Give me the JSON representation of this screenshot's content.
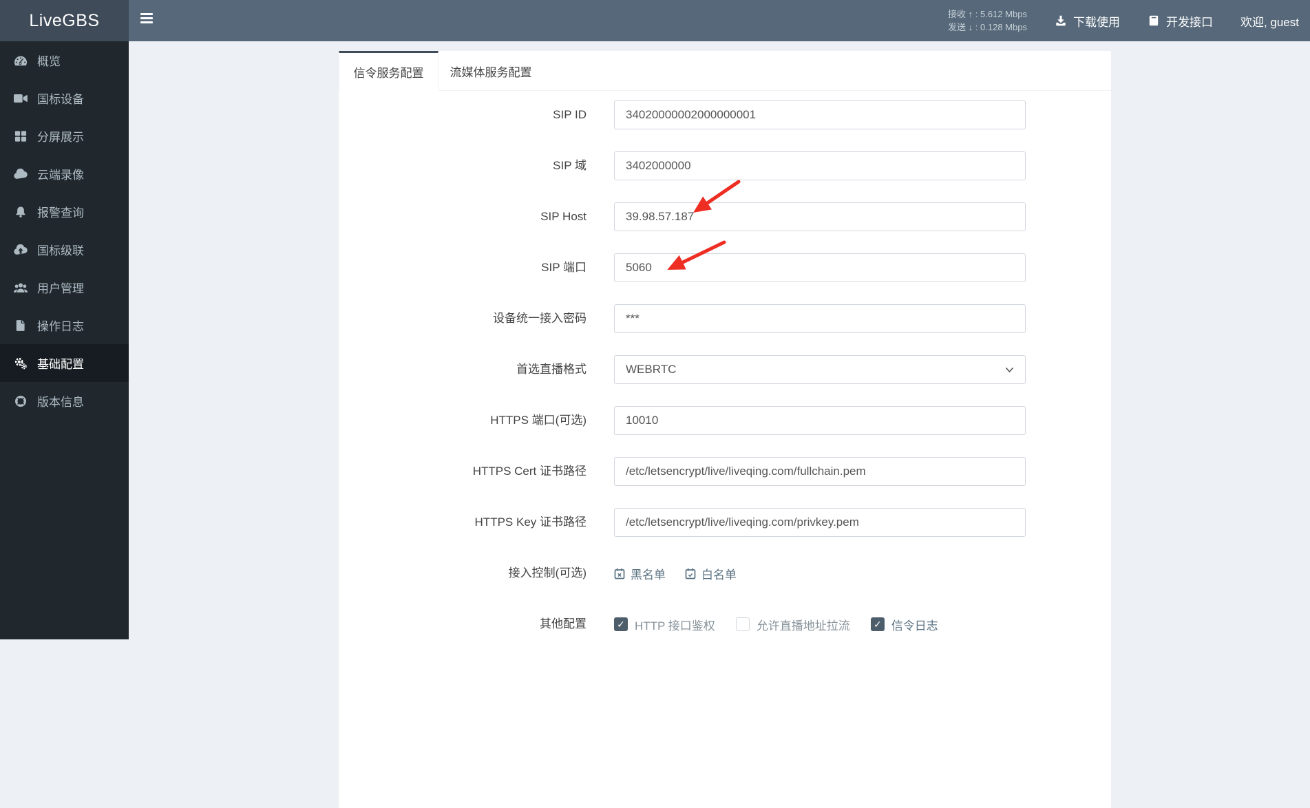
{
  "topbar": {
    "brand": "LiveGBS",
    "stats": {
      "recv_label": "接收",
      "recv_arrow": "↑",
      "recv_value": "5.612 Mbps",
      "send_label": "发送",
      "send_arrow": "↓",
      "send_value": "0.128 Mbps",
      "sep": ":"
    },
    "nav": [
      {
        "id": "download",
        "icon": "download-icon",
        "label": "下载使用"
      },
      {
        "id": "dev-api",
        "icon": "book-icon",
        "label": "开发接口"
      },
      {
        "id": "welcome-user",
        "icon": "",
        "label": "欢迎, guest"
      }
    ]
  },
  "sidebar": {
    "items": [
      {
        "id": "overview",
        "icon": "gauge-icon",
        "label": "概览",
        "active": false
      },
      {
        "id": "gb-devices",
        "icon": "video-camera-icon",
        "label": "国标设备",
        "active": false
      },
      {
        "id": "split-screen",
        "icon": "grid-icon",
        "label": "分屏展示",
        "active": false
      },
      {
        "id": "cloud-record",
        "icon": "cloud-icon",
        "label": "云端录像",
        "active": false
      },
      {
        "id": "alarm-query",
        "icon": "bell-icon",
        "label": "报警查询",
        "active": false
      },
      {
        "id": "gb-cascade",
        "icon": "cloud-upload-icon",
        "label": "国标级联",
        "active": false
      },
      {
        "id": "user-management",
        "icon": "users-icon",
        "label": "用户管理",
        "active": false
      },
      {
        "id": "operation-log",
        "icon": "file-icon",
        "label": "操作日志",
        "active": false
      },
      {
        "id": "basic-config",
        "icon": "gears-icon",
        "label": "基础配置",
        "active": true
      },
      {
        "id": "version-info",
        "icon": "ring-icon",
        "label": "版本信息",
        "active": false
      }
    ]
  },
  "tabs": [
    {
      "id": "signal-service-config",
      "label": "信令服务配置",
      "active": true
    },
    {
      "id": "media-service-config",
      "label": "流媒体服务配置",
      "active": false
    }
  ],
  "form": {
    "rows": [
      {
        "id": "sip-id",
        "label": "SIP ID",
        "value": "34020000002000000001"
      },
      {
        "id": "sip-domain",
        "label": "SIP 域",
        "value": "3402000000"
      },
      {
        "id": "sip-host",
        "label": "SIP Host",
        "value": "39.98.57.187"
      },
      {
        "id": "sip-port",
        "label": "SIP 端口",
        "value": "5060"
      },
      {
        "id": "device-access-password",
        "label": "设备统一接入密码",
        "value": "***"
      },
      {
        "id": "preferred-live-format",
        "label": "首选直播格式",
        "value": "WEBRTC",
        "type": "select"
      },
      {
        "id": "https-port",
        "label": "HTTPS 端口(可选)",
        "value": "10010"
      },
      {
        "id": "https-cert-path",
        "label": "HTTPS Cert 证书路径",
        "value": "/etc/letsencrypt/live/liveqing.com/fullchain.pem"
      },
      {
        "id": "https-key-path",
        "label": "HTTPS Key 证书路径",
        "value": "/etc/letsencrypt/live/liveqing.com/privkey.pem"
      }
    ],
    "access_control": {
      "label": "接入控制(可选)",
      "links": [
        {
          "id": "blacklist",
          "icon": "calendar-times-icon",
          "label": "黑名单"
        },
        {
          "id": "whitelist",
          "icon": "calendar-check-icon",
          "label": "白名单"
        }
      ]
    },
    "other_config": {
      "label": "其他配置",
      "checkboxes": [
        {
          "id": "http-api-auth",
          "label": "HTTP 接口鉴权",
          "checked": true
        },
        {
          "id": "allow-live-pull",
          "label": "允许直播地址拉流",
          "checked": false
        },
        {
          "id": "signal-log",
          "label": "信令日志",
          "checked": true
        }
      ]
    }
  },
  "colors": {
    "navbar": "#566879",
    "logo_bg": "#3f4b58",
    "sidebar_bg": "#20282e",
    "sidebar_active_bg": "#161c21",
    "accent_arrow": "#ee2d23",
    "input_border": "#d2d6de",
    "checkbox_checked": "#4d5d6a",
    "link_slate": "#5a7282"
  }
}
